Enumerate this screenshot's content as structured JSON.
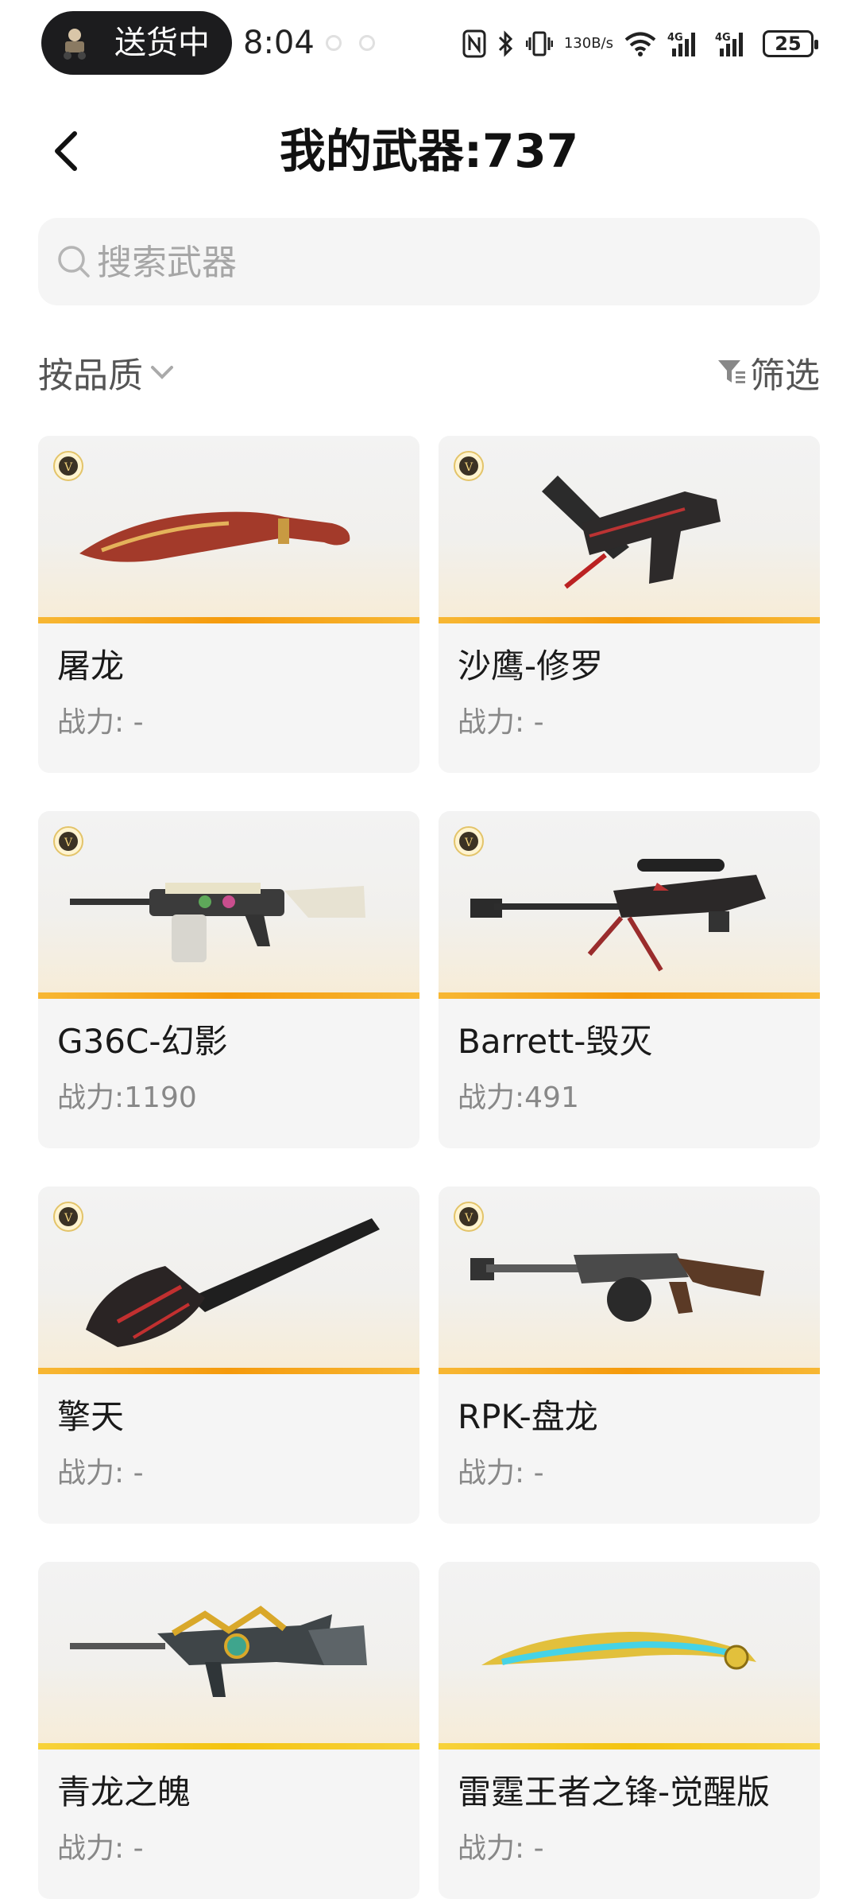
{
  "status_bar": {
    "pill_label": "送货中",
    "time": "8:04",
    "speed_top": "130",
    "speed_bottom": "B/s",
    "battery": "25",
    "icons": [
      "nfc-icon",
      "bluetooth-icon",
      "vibrate-icon",
      "wifi-icon",
      "signal-4g-icon",
      "signal-4g-icon"
    ]
  },
  "header": {
    "back_icon": "chevron-left-icon",
    "title": "我的武器:737"
  },
  "search": {
    "placeholder": "搜索武器",
    "value": ""
  },
  "toolbar": {
    "sort_label": "按品质",
    "filter_label": "筛选"
  },
  "colors": {
    "accent_bar": "#f59a0c",
    "accent_bar_gold": "#f4c411",
    "card_bg": "#f5f5f5"
  },
  "weapons": [
    {
      "name": "屠龙",
      "power": "战力: -",
      "badge": "V",
      "icon": "kukri-knife-icon"
    },
    {
      "name": "沙鹰-修罗",
      "power": "战力: -",
      "badge": "V",
      "icon": "desert-eagle-pistol-icon"
    },
    {
      "name": "G36C-幻影",
      "power": "战力:1190",
      "badge": "V",
      "icon": "assault-rifle-icon"
    },
    {
      "name": "Barrett-毁灭",
      "power": "战力:491",
      "badge": "V",
      "icon": "sniper-rifle-icon"
    },
    {
      "name": "擎天",
      "power": "战力: -",
      "badge": "V",
      "icon": "shovel-icon"
    },
    {
      "name": "RPK-盘龙",
      "power": "战力: -",
      "badge": "V",
      "icon": "machine-gun-icon"
    },
    {
      "name": "青龙之魄",
      "power": "战力: -",
      "badge": "",
      "icon": "golden-rifle-icon"
    },
    {
      "name": "雷霆王者之锋-觉醒版",
      "power": "战力: -",
      "badge": "",
      "icon": "golden-blade-icon"
    }
  ]
}
